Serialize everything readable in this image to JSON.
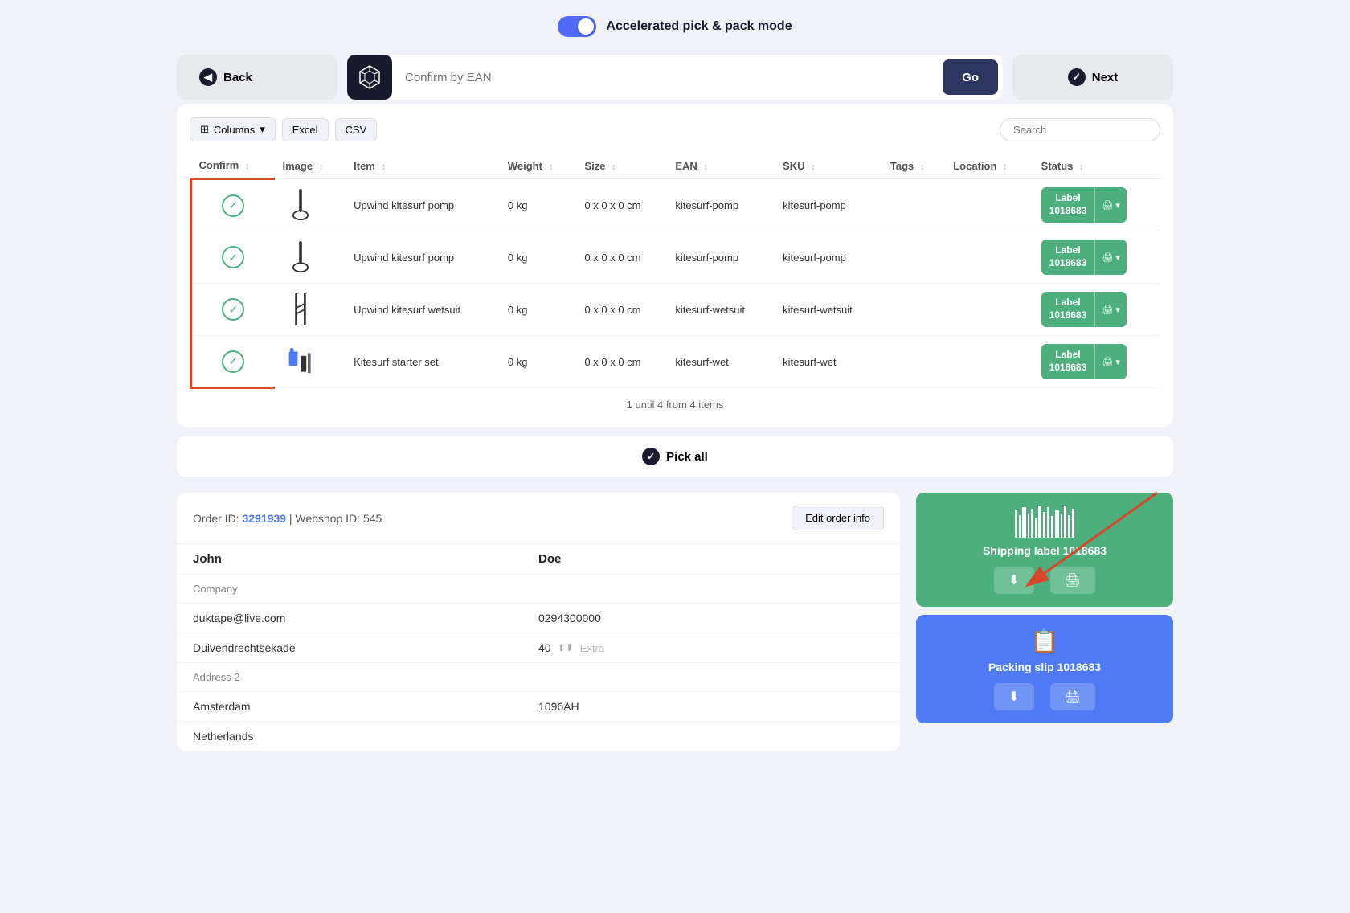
{
  "topbar": {
    "toggle_label": "Accelerated pick & pack mode",
    "toggle_on": true
  },
  "navbar": {
    "back_label": "Back",
    "ean_placeholder": "Confirm by EAN",
    "go_label": "Go",
    "next_label": "Next"
  },
  "toolbar": {
    "columns_label": "Columns",
    "excel_label": "Excel",
    "csv_label": "CSV",
    "search_placeholder": "Search"
  },
  "table": {
    "columns": [
      "Confirm",
      "Image",
      "Item",
      "Weight",
      "Size",
      "EAN",
      "SKU",
      "Tags",
      "Location",
      "Status"
    ],
    "rows": [
      {
        "confirmed": true,
        "item": "Upwind kitesurf pomp",
        "weight": "0 kg",
        "size": "0 x 0 x 0 cm",
        "ean": "kitesurf-pomp",
        "sku": "kitesurf-pomp",
        "tags": "",
        "location": "",
        "label": "Label\n1018683",
        "image_type": "pump"
      },
      {
        "confirmed": true,
        "item": "Upwind kitesurf pomp",
        "weight": "0 kg",
        "size": "0 x 0 x 0 cm",
        "ean": "kitesurf-pomp",
        "sku": "kitesurf-pomp",
        "tags": "",
        "location": "",
        "label": "Label\n1018683",
        "image_type": "pump"
      },
      {
        "confirmed": true,
        "item": "Upwind kitesurf wetsuit",
        "weight": "0 kg",
        "size": "0 x 0 x 0 cm",
        "ean": "kitesurf-wetsuit",
        "sku": "kitesurf-wetsuit",
        "tags": "",
        "location": "",
        "label": "Label\n1018683",
        "image_type": "wetsuit"
      },
      {
        "confirmed": true,
        "item": "Kitesurf starter set",
        "weight": "0 kg",
        "size": "0 x 0 x 0 cm",
        "ean": "kitesurf-wet",
        "sku": "kitesurf-wet",
        "tags": "",
        "location": "",
        "label": "Label\n1018683",
        "image_type": "set"
      }
    ],
    "pagination": "1 until 4 from 4 items"
  },
  "pick_all_label": "Pick all",
  "order": {
    "id": "3291939",
    "webshop_id": "545",
    "edit_label": "Edit order info",
    "first_name": "John",
    "last_name": "Doe",
    "company_placeholder": "Company",
    "email": "duktape@live.com",
    "phone": "0294300000",
    "street": "Duivendrechtsekade",
    "number": "40",
    "extra_placeholder": "Extra",
    "address2_placeholder": "Address 2",
    "city": "Amsterdam",
    "postal": "1096AH",
    "country": "Netherlands"
  },
  "labels": {
    "shipping_label": "Shipping label 1018683",
    "packing_slip": "Packing slip 1018683"
  },
  "colors": {
    "green": "#4caf7d",
    "blue": "#4e7af6",
    "dark": "#1a1a2e",
    "orange_border": "#d9472b"
  }
}
